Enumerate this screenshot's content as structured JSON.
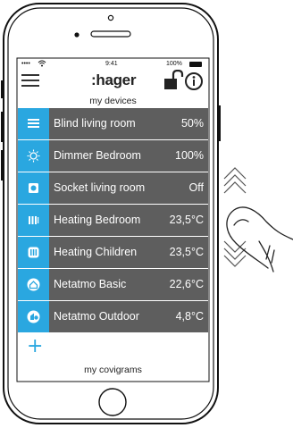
{
  "status_bar": {
    "carrier": "•••• ",
    "time": "9:41",
    "battery": "100%"
  },
  "header": {
    "logo": ":hager"
  },
  "devices_section": {
    "title": "my devices"
  },
  "devices": [
    {
      "name": "Blind living room",
      "value": "50%",
      "icon": "blind-icon"
    },
    {
      "name": "Dimmer Bedroom",
      "value": "100%",
      "icon": "bulb-icon"
    },
    {
      "name": "Socket living room",
      "value": "Off",
      "icon": "socket-icon"
    },
    {
      "name": "Heating Bedroom",
      "value": "23,5°C",
      "icon": "radiator-icon"
    },
    {
      "name": "Heating Children",
      "value": "23,5°C",
      "icon": "radiator-icon"
    },
    {
      "name": "Netatmo Basic",
      "value": "22,6°C",
      "icon": "home-station-icon"
    },
    {
      "name": "Netatmo Outdoor",
      "value": "4,8°C",
      "icon": "outdoor-station-icon"
    }
  ],
  "covigrams_section": {
    "title": "my covigrams"
  },
  "colors": {
    "accent": "#2aa7e0",
    "row_bg": "#5e5e5e",
    "row_text": "#ffffff"
  }
}
